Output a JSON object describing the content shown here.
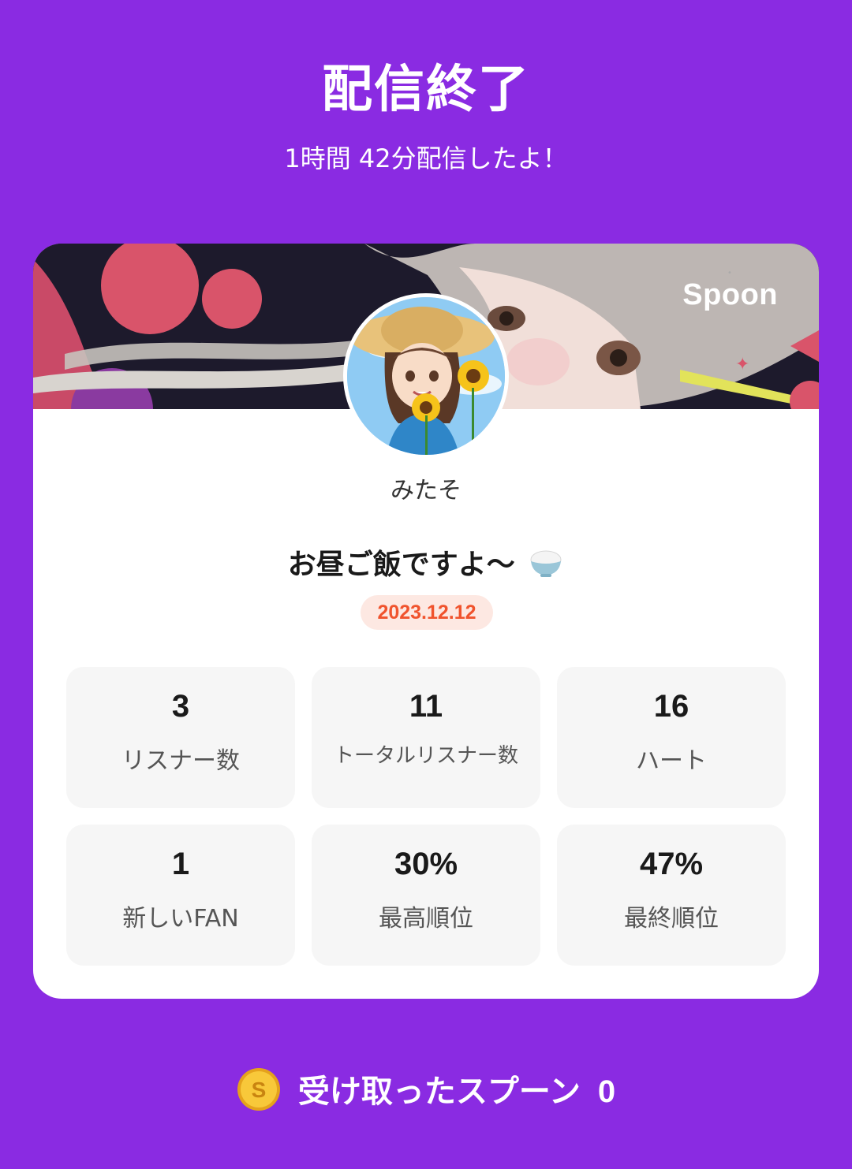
{
  "header": {
    "title": "配信終了",
    "duration_text": "1時間 42分配信したよ！"
  },
  "card": {
    "brand": "Spoon",
    "username": "みたそ",
    "stream_title": "お昼ご飯ですよ〜",
    "stream_title_emoji": "rice-bowl-icon",
    "date": "2023.12.12",
    "stats": [
      {
        "value": "3",
        "label": "リスナー数"
      },
      {
        "value": "11",
        "label": "トータルリスナー数"
      },
      {
        "value": "16",
        "label": "ハート"
      },
      {
        "value": "1",
        "label": "新しいFAN"
      },
      {
        "value": "30%",
        "label": "最高順位"
      },
      {
        "value": "47%",
        "label": "最終順位"
      }
    ]
  },
  "footer": {
    "received_label": "受け取ったスプーン",
    "received_count": "0",
    "coin_icon": "spoon-coin-icon"
  },
  "colors": {
    "background": "#8a2be2",
    "date_badge_bg": "#fde8e2",
    "date_badge_text": "#f0532d",
    "stat_bg": "#f6f6f6"
  }
}
